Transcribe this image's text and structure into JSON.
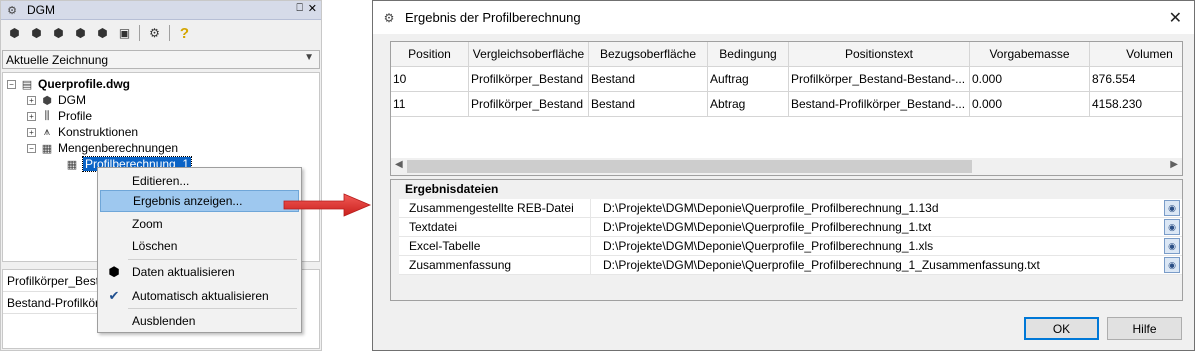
{
  "panel": {
    "title": "DGM",
    "pin_glyph": "⎕",
    "close_glyph": "✕",
    "combo_value": "Aktuelle Zeichnung",
    "tree": {
      "root": "Querprofile.dwg",
      "items": [
        "DGM",
        "Profile",
        "Konstruktionen",
        "Mengenberechnungen"
      ],
      "selected": "Profilberechnung_1"
    },
    "lower_rows": [
      "Profilkörper_Bestand",
      "Bestand-Profilkörper"
    ]
  },
  "context_menu": {
    "items": [
      {
        "label": "Editieren..."
      },
      {
        "label": "Ergebnis anzeigen..."
      },
      {
        "label": "Zoom"
      },
      {
        "label": "Löschen"
      },
      {
        "label": "Daten aktualisieren",
        "icon": "refresh-data-icon"
      },
      {
        "label": "Automatisch aktualisieren",
        "icon": "checkmark-icon"
      },
      {
        "label": "Ausblenden"
      }
    ]
  },
  "dialog": {
    "title": "Ergebnis der Profilberechnung",
    "columns": [
      "Position",
      "Vergleichsoberfläche",
      "Bezugsoberfläche",
      "Bedingung",
      "Positionstext",
      "Vorgabemasse",
      "Volumen"
    ],
    "rows": [
      [
        "10",
        "Profilkörper_Bestand",
        "Bestand",
        "Auftrag",
        "Profilkörper_Bestand-Bestand-...",
        "0.000",
        "876.554"
      ],
      [
        "11",
        "Profilkörper_Bestand",
        "Bestand",
        "Abtrag",
        "Bestand-Profilkörper_Bestand-...",
        "0.000",
        "4158.230"
      ]
    ],
    "files_header": "Ergebnisdateien",
    "files": [
      {
        "label": "Zusammengestellte REB-Datei",
        "path": "D:\\Projekte\\DGM\\Deponie\\Querprofile_Profilberechnung_1.13d"
      },
      {
        "label": "Textdatei",
        "path": "D:\\Projekte\\DGM\\Deponie\\Querprofile_Profilberechnung_1.txt"
      },
      {
        "label": "Excel-Tabelle",
        "path": "D:\\Projekte\\DGM\\Deponie\\Querprofile_Profilberechnung_1.xls"
      },
      {
        "label": "Zusammenfassung",
        "path": "D:\\Projekte\\DGM\\Deponie\\Querprofile_Profilberechnung_1_Zusammenfassung.txt"
      }
    ],
    "ok_label": "OK",
    "help_label": "Hilfe"
  },
  "colors": {
    "selection": "#0a63c6",
    "menu_highlight": "#9ec8ef",
    "arrow": "#e8312f"
  }
}
